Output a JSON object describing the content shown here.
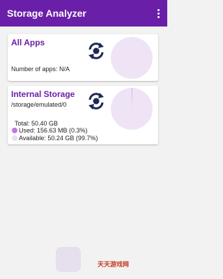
{
  "appbar": {
    "title": "Storage Analyzer"
  },
  "colors": {
    "primary": "#6a1fa8",
    "pie_fill": "#efe4f6",
    "used": "#c07ad8",
    "available": "#e8dff0"
  },
  "all_apps": {
    "title": "All Apps",
    "count_text": "Number of apps: N/A"
  },
  "internal_storage": {
    "title": "Internal Storage",
    "path": "/storage/emulated/0",
    "total": "Total: 50.40 GB",
    "used": "Used: 156.63 MB (0.3%)",
    "available": "Available: 50.24 GB (99.7%)",
    "used_fraction": 0.003
  },
  "watermark": {
    "text": "天天游戏网"
  }
}
